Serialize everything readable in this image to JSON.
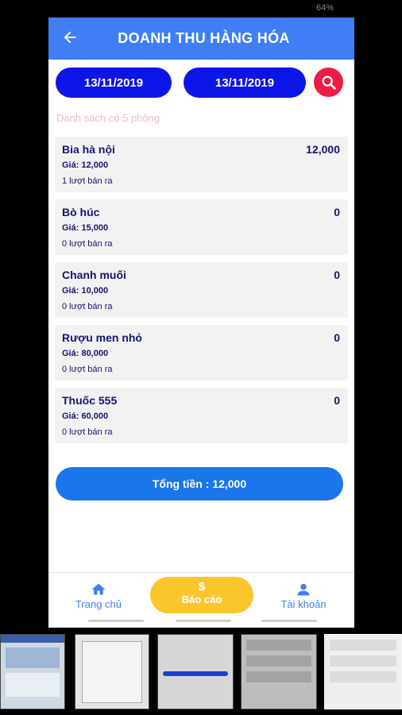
{
  "status": {
    "battery": "64%"
  },
  "header": {
    "title": "DOANH THU HÀNG HÓA"
  },
  "filters": {
    "from_date": "13/11/2019",
    "to_date": "13/11/2019"
  },
  "list": {
    "count_text": "Danh sách có 5 phòng",
    "items": [
      {
        "name": "Bia hà nội",
        "amount": "12,000",
        "price": "Giá: 12,000",
        "sold": "1 lượt bán ra"
      },
      {
        "name": "Bò húc",
        "amount": "0",
        "price": "Giá: 15,000",
        "sold": "0 lượt bán ra"
      },
      {
        "name": "Chanh muối",
        "amount": "0",
        "price": "Giá: 10,000",
        "sold": "0 lượt bán ra"
      },
      {
        "name": "Rượu men nhỏ",
        "amount": "0",
        "price": "Giá: 80,000",
        "sold": "0 lượt bán ra"
      },
      {
        "name": "Thuốc 555",
        "amount": "0",
        "price": "Giá: 60,000",
        "sold": "0 lượt bán ra"
      }
    ]
  },
  "total": {
    "label": "Tổng tiền : 12,000"
  },
  "nav": {
    "home": "Trang chủ",
    "report_symbol": "$",
    "report": "Báo cáo",
    "account": "Tài khoản"
  },
  "colors": {
    "primary": "#3f7ef5",
    "date_button": "#0d14e6",
    "search": "#ee1b43",
    "report": "#fbc52c",
    "total": "#1a76ea"
  }
}
